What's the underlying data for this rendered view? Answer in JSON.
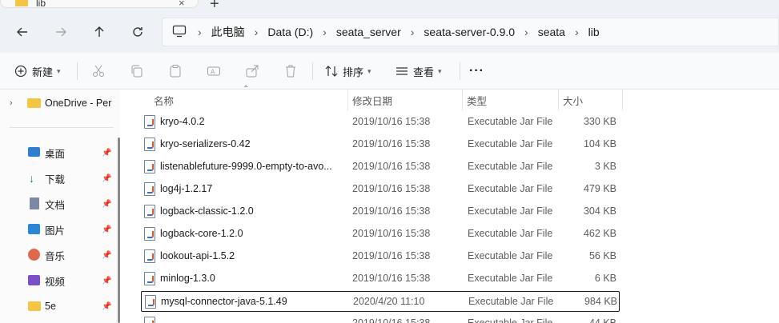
{
  "tab": {
    "title": "lib",
    "close": "×",
    "new": "+"
  },
  "nav": {
    "breadcrumbs": [
      "此电脑",
      "Data (D:)",
      "seata_server",
      "seata-server-0.9.0",
      "seata",
      "lib"
    ],
    "separator": "›"
  },
  "toolbar": {
    "new_label": "新建",
    "sort_label": "排序",
    "view_label": "查看",
    "more": "···"
  },
  "sidebar": {
    "onedrive": "OneDrive - Per",
    "items": [
      {
        "label": "桌面",
        "icon": "desktop-icon"
      },
      {
        "label": "下载",
        "icon": "download-icon"
      },
      {
        "label": "文档",
        "icon": "documents-icon"
      },
      {
        "label": "图片",
        "icon": "pictures-icon"
      },
      {
        "label": "音乐",
        "icon": "music-icon"
      },
      {
        "label": "视频",
        "icon": "videos-icon"
      },
      {
        "label": "5e",
        "icon": "folder-icon"
      }
    ]
  },
  "columns": {
    "name": "名称",
    "date": "修改日期",
    "type": "类型",
    "size": "大小"
  },
  "files": [
    {
      "name": "kryo-4.0.2",
      "date": "2019/10/16 15:38",
      "type": "Executable Jar File",
      "size": "330 KB"
    },
    {
      "name": "kryo-serializers-0.42",
      "date": "2019/10/16 15:38",
      "type": "Executable Jar File",
      "size": "104 KB"
    },
    {
      "name": "listenablefuture-9999.0-empty-to-avo...",
      "date": "2019/10/16 15:38",
      "type": "Executable Jar File",
      "size": "3 KB"
    },
    {
      "name": "log4j-1.2.17",
      "date": "2019/10/16 15:38",
      "type": "Executable Jar File",
      "size": "479 KB"
    },
    {
      "name": "logback-classic-1.2.0",
      "date": "2019/10/16 15:38",
      "type": "Executable Jar File",
      "size": "304 KB"
    },
    {
      "name": "logback-core-1.2.0",
      "date": "2019/10/16 15:38",
      "type": "Executable Jar File",
      "size": "462 KB"
    },
    {
      "name": "lookout-api-1.5.2",
      "date": "2019/10/16 15:38",
      "type": "Executable Jar File",
      "size": "56 KB"
    },
    {
      "name": "minlog-1.3.0",
      "date": "2019/10/16 15:38",
      "type": "Executable Jar File",
      "size": "6 KB"
    },
    {
      "name": "mysql-connector-java-5.1.49",
      "date": "2020/4/20 11:10",
      "type": "Executable Jar File",
      "size": "984 KB"
    },
    {
      "name": "",
      "date": "2019/10/16 15:38",
      "type": "Executable Jar File",
      "size": "44 KB"
    }
  ],
  "colors": {
    "chrome_bg": "#eef1f6",
    "folder": "#f4c542",
    "accent": "#0067c0"
  }
}
